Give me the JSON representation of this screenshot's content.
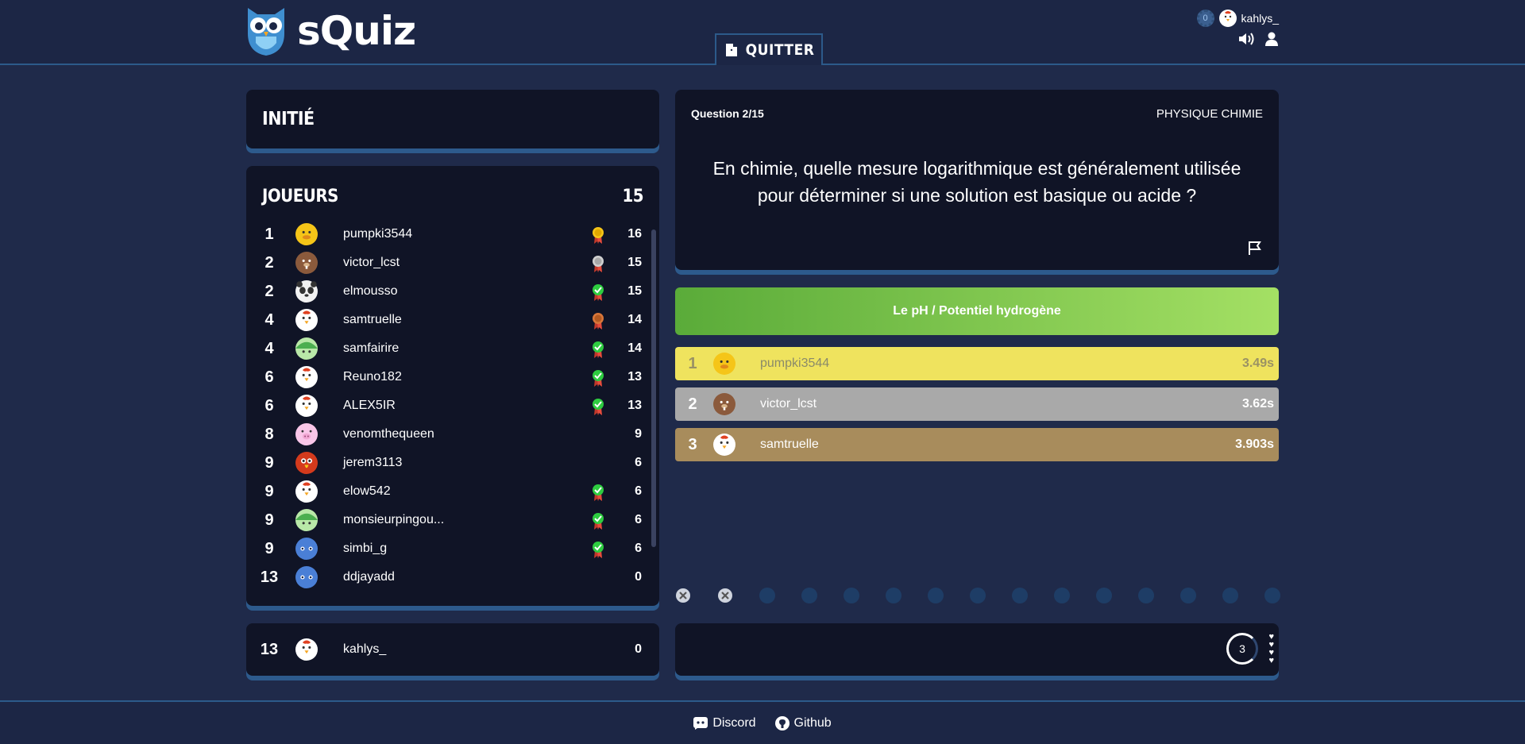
{
  "app": {
    "title": "sQuiz"
  },
  "header": {
    "quit_label": "QUITTER",
    "user": {
      "notifications": "0",
      "username": "kahlys_"
    }
  },
  "level": {
    "title": "INITIÉ"
  },
  "players": {
    "title": "JOUEURS",
    "count": "15",
    "items": [
      {
        "rank": "1",
        "name": "pumpki3544",
        "score": "16",
        "avatar": "duck",
        "badge": "gold"
      },
      {
        "rank": "2",
        "name": "victor_lcst",
        "score": "15",
        "avatar": "beaver",
        "badge": "silver"
      },
      {
        "rank": "2",
        "name": "elmousso",
        "score": "15",
        "avatar": "panda",
        "badge": "check"
      },
      {
        "rank": "4",
        "name": "samtruelle",
        "score": "14",
        "avatar": "chicken",
        "badge": "bronze"
      },
      {
        "rank": "4",
        "name": "samfairire",
        "score": "14",
        "avatar": "turtle",
        "badge": "check"
      },
      {
        "rank": "6",
        "name": "Reuno182",
        "score": "13",
        "avatar": "chicken",
        "badge": "check"
      },
      {
        "rank": "6",
        "name": "ALEX5IR",
        "score": "13",
        "avatar": "chicken",
        "badge": "check"
      },
      {
        "rank": "8",
        "name": "venomthequeen",
        "score": "9",
        "avatar": "pig",
        "badge": ""
      },
      {
        "rank": "9",
        "name": "jerem3113",
        "score": "6",
        "avatar": "parrot",
        "badge": ""
      },
      {
        "rank": "9",
        "name": "elow542",
        "score": "6",
        "avatar": "chicken",
        "badge": "check"
      },
      {
        "rank": "9",
        "name": "monsieurpingou...",
        "score": "6",
        "avatar": "turtle",
        "badge": "check"
      },
      {
        "rank": "9",
        "name": "simbi_g",
        "score": "6",
        "avatar": "fish",
        "badge": "check"
      },
      {
        "rank": "13",
        "name": "ddjayadd",
        "score": "0",
        "avatar": "fish",
        "badge": ""
      }
    ]
  },
  "me": {
    "rank": "13",
    "name": "kahlys_",
    "score": "0"
  },
  "question": {
    "number": "Question 2/15",
    "category": "PHYSIQUE CHIMIE",
    "text": "En chimie, quelle mesure logarithmique est généralement utilisée pour déterminer si une solution est basique ou acide ?"
  },
  "answer": {
    "text": "Le pH / Potentiel hydrogène"
  },
  "ranking": [
    {
      "rank": "1",
      "name": "pumpki3544",
      "time": "3.49s",
      "color": "#efe35e"
    },
    {
      "rank": "2",
      "name": "victor_lcst",
      "time": "3.62s",
      "color": "#a9a9a9"
    },
    {
      "rank": "3",
      "name": "samtruelle",
      "time": "3.903s",
      "color": "#a88c5c"
    }
  ],
  "progress": {
    "answered_wrong": 2,
    "total": 15
  },
  "timer": {
    "value": "3",
    "lives": 4
  },
  "footer": {
    "discord": "Discord",
    "github": "Github"
  },
  "colors": {
    "bg": "#1f2a4a",
    "panel": "#101426",
    "accent": "#2d5a8c",
    "answer_start": "#5aab39",
    "answer_end": "#a4e064"
  }
}
